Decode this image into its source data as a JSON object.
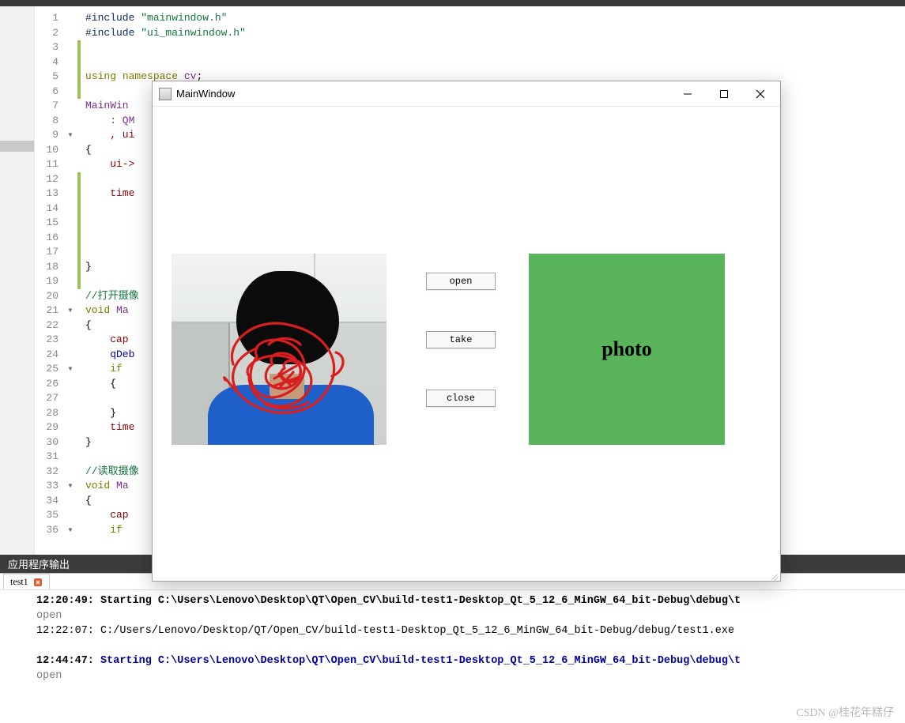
{
  "dialog": {
    "title": "MainWindow",
    "buttons": {
      "open": "open",
      "take": "take",
      "close": "close"
    },
    "photo_label": "photo"
  },
  "editor": {
    "line_numbers": [
      "1",
      "2",
      "3",
      "4",
      "5",
      "6",
      "7",
      "8",
      "9",
      "10",
      "11",
      "12",
      "13",
      "14",
      "15",
      "16",
      "17",
      "18",
      "19",
      "20",
      "21",
      "22",
      "23",
      "24",
      "25",
      "26",
      "27",
      "28",
      "29",
      "30",
      "31",
      "32",
      "33",
      "34",
      "35",
      "36"
    ],
    "fold_markers": {
      "9": "▾",
      "21": "▾",
      "25": "▾",
      "33": "▾",
      "36": "▾"
    },
    "changed_lines": [
      3,
      4,
      5,
      6,
      12,
      13,
      14,
      15,
      16,
      17,
      18,
      19
    ],
    "code": {
      "l1": {
        "a": "#include ",
        "b": "\"mainwindow.h\""
      },
      "l2": {
        "a": "#include ",
        "b": "\"ui_mainwindow.h\""
      },
      "l5": {
        "a": "using ",
        "b": "namespace ",
        "c": "cv",
        "d": ";"
      },
      "l7": "MainWin",
      "l8": "    : QM",
      "l9": "    , ui",
      "l10": "{",
      "l11": "    ui->",
      "l13": "    time",
      "l18": "}",
      "l20": "//打开摄像",
      "l21a": "void",
      "l21b": " Ma",
      "l22": "{",
      "l23": "    cap",
      "l24": "    qDeb",
      "l25a": "    if",
      "l25b": " ",
      "l26": "    {",
      "l28": "    }",
      "l29": "    time",
      "l30": "}",
      "l32": "//读取摄像",
      "l33a": "void",
      "l33b": " Ma",
      "l34": "{",
      "l35": "    cap",
      "l36a": "    if",
      "l36b": " "
    }
  },
  "output": {
    "panel_title": "应用程序输出",
    "tab_name": "test1",
    "lines": [
      {
        "ts": "12:20:49: ",
        "txt": "Starting C:\\Users\\Lenovo\\Desktop\\QT\\Open_CV\\build-test1-Desktop_Qt_5_12_6_MinGW_64_bit-Debug\\debug\\t",
        "bold": true
      },
      {
        "txt": "open",
        "gray": true
      },
      {
        "ts": "12:22:07: ",
        "txt": "C:/Users/Lenovo/Desktop/QT/Open_CV/build-test1-Desktop_Qt_5_12_6_MinGW_64_bit-Debug/debug/test1.exe "
      },
      {
        "txt": " "
      },
      {
        "ts": "12:44:47: ",
        "txt": "Starting C:\\Users\\Lenovo\\Desktop\\QT\\Open_CV\\build-test1-Desktop_Qt_5_12_6_MinGW_64_bit-Debug\\debug\\t",
        "bold": true,
        "blue": true
      },
      {
        "txt": "open",
        "gray": true
      }
    ]
  },
  "watermark": "CSDN @桂花年糕仔"
}
